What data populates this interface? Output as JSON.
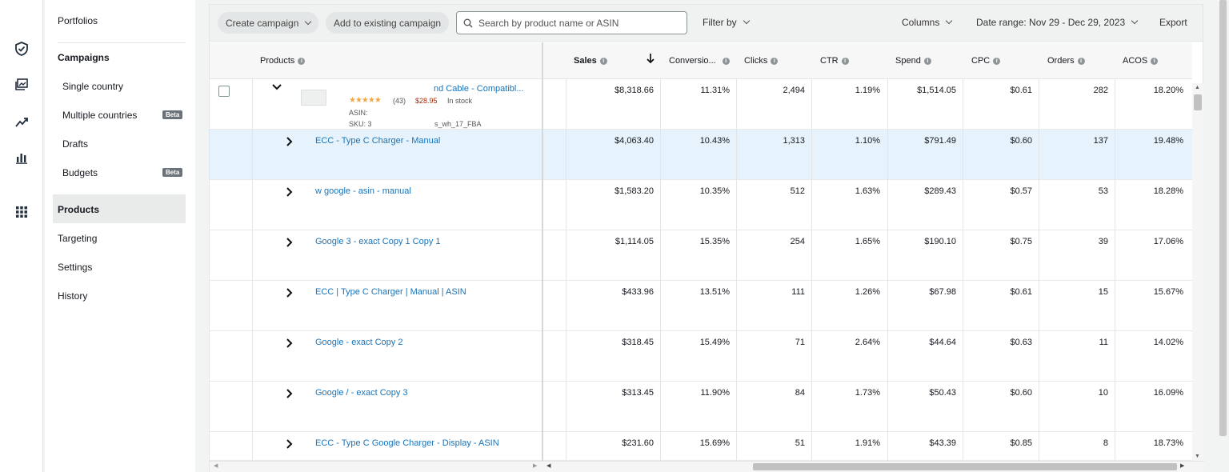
{
  "rail": {
    "icons": [
      "shield-icon",
      "ad-gallery-icon",
      "trend-chart-icon",
      "bar-chart-icon",
      "app-grid-icon"
    ]
  },
  "nav": {
    "portfolios": "Portfolios",
    "campaigns": "Campaigns",
    "single_country": "Single country",
    "multiple_countries": "Multiple countries",
    "beta": "Beta",
    "drafts": "Drafts",
    "budgets": "Budgets",
    "products": "Products",
    "targeting": "Targeting",
    "settings": "Settings",
    "history": "History"
  },
  "toolbar": {
    "create_campaign": "Create campaign",
    "add_existing": "Add to existing campaign",
    "search_placeholder": "Search by product name or ASIN",
    "filter_by": "Filter by",
    "columns": "Columns",
    "date_range": "Date range: Nov 29 - Dec 29, 2023",
    "export": "Export"
  },
  "columns": {
    "products": "Products",
    "sales": "Sales",
    "conversion": "Conversio...",
    "clicks": "Clicks",
    "ctr": "CTR",
    "spend": "Spend",
    "cpc": "CPC",
    "orders": "Orders",
    "acos": "ACOS"
  },
  "product": {
    "title": "nd Cable - Compatibl...",
    "rating_count": "(43)",
    "price": "$28.95",
    "stock": "In stock",
    "asin_label": "ASIN:",
    "sku_label": "SKU: 3",
    "sku_suffix": "s_wh_17_FBA",
    "sales": "$8,318.66",
    "conversion": "11.31%",
    "clicks": "2,494",
    "ctr": "1.19%",
    "spend": "$1,514.05",
    "cpc": "$0.61",
    "orders": "282",
    "acos": "18.20%"
  },
  "rows": [
    {
      "name": "ECC - Type C Charger - Manual",
      "sales": "$4,063.40",
      "conversion": "10.43%",
      "clicks": "1,313",
      "ctr": "1.10%",
      "spend": "$791.49",
      "cpc": "$0.60",
      "orders": "137",
      "acos": "19.48%"
    },
    {
      "name": "w google - asin - manual",
      "sales": "$1,583.20",
      "conversion": "10.35%",
      "clicks": "512",
      "ctr": "1.63%",
      "spend": "$289.43",
      "cpc": "$0.57",
      "orders": "53",
      "acos": "18.28%"
    },
    {
      "name": "Google 3 - exact Copy 1 Copy 1",
      "sales": "$1,114.05",
      "conversion": "15.35%",
      "clicks": "254",
      "ctr": "1.65%",
      "spend": "$190.10",
      "cpc": "$0.75",
      "orders": "39",
      "acos": "17.06%"
    },
    {
      "name": "ECC | Type C Charger | Manual | ASIN",
      "sales": "$433.96",
      "conversion": "13.51%",
      "clicks": "111",
      "ctr": "1.26%",
      "spend": "$67.98",
      "cpc": "$0.61",
      "orders": "15",
      "acos": "15.67%"
    },
    {
      "name": "Google - exact Copy 2",
      "sales": "$318.45",
      "conversion": "15.49%",
      "clicks": "71",
      "ctr": "2.64%",
      "spend": "$44.64",
      "cpc": "$0.63",
      "orders": "11",
      "acos": "14.02%"
    },
    {
      "name": "Google / - exact Copy 3",
      "sales": "$313.45",
      "conversion": "11.90%",
      "clicks": "84",
      "ctr": "1.73%",
      "spend": "$50.43",
      "cpc": "$0.60",
      "orders": "10",
      "acos": "16.09%"
    },
    {
      "name": "ECC - Type C Google Charger - Display - ASIN",
      "sales": "$231.60",
      "conversion": "15.69%",
      "clicks": "51",
      "ctr": "1.91%",
      "spend": "$43.39",
      "cpc": "$0.85",
      "orders": "8",
      "acos": "18.73%"
    }
  ]
}
